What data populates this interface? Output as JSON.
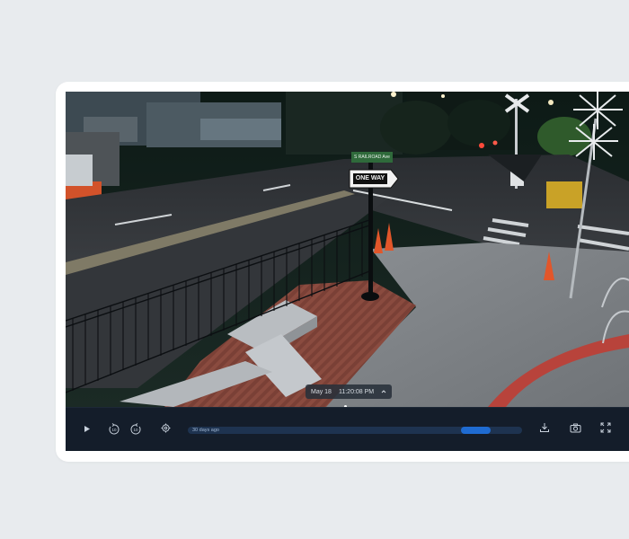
{
  "video": {
    "timestamp_date": "May 18",
    "timestamp_time": "11:20:08 PM",
    "scene_signs": {
      "street_sign": "S RAILROAD Ave",
      "one_way": "ONE WAY"
    }
  },
  "controls": {
    "play_icon": "play-icon",
    "rewind_icon": "rewind-10-icon",
    "forward_icon": "forward-10-icon",
    "settings_icon": "settings-icon",
    "download_icon": "download-icon",
    "snapshot_icon": "camera-icon",
    "fullscreen_icon": "fullscreen-icon",
    "rewind_label": "10",
    "forward_label": "10"
  },
  "timeline": {
    "label": "30 days ago",
    "playback_position": 0.905,
    "fill_width_fraction": 0.09
  },
  "colors": {
    "page_bg": "#e8ebee",
    "card_bg": "#ffffff",
    "control_bar": "#141d2a",
    "timeline_track": "#1e3350",
    "timeline_fill": "#1f6bd1"
  }
}
